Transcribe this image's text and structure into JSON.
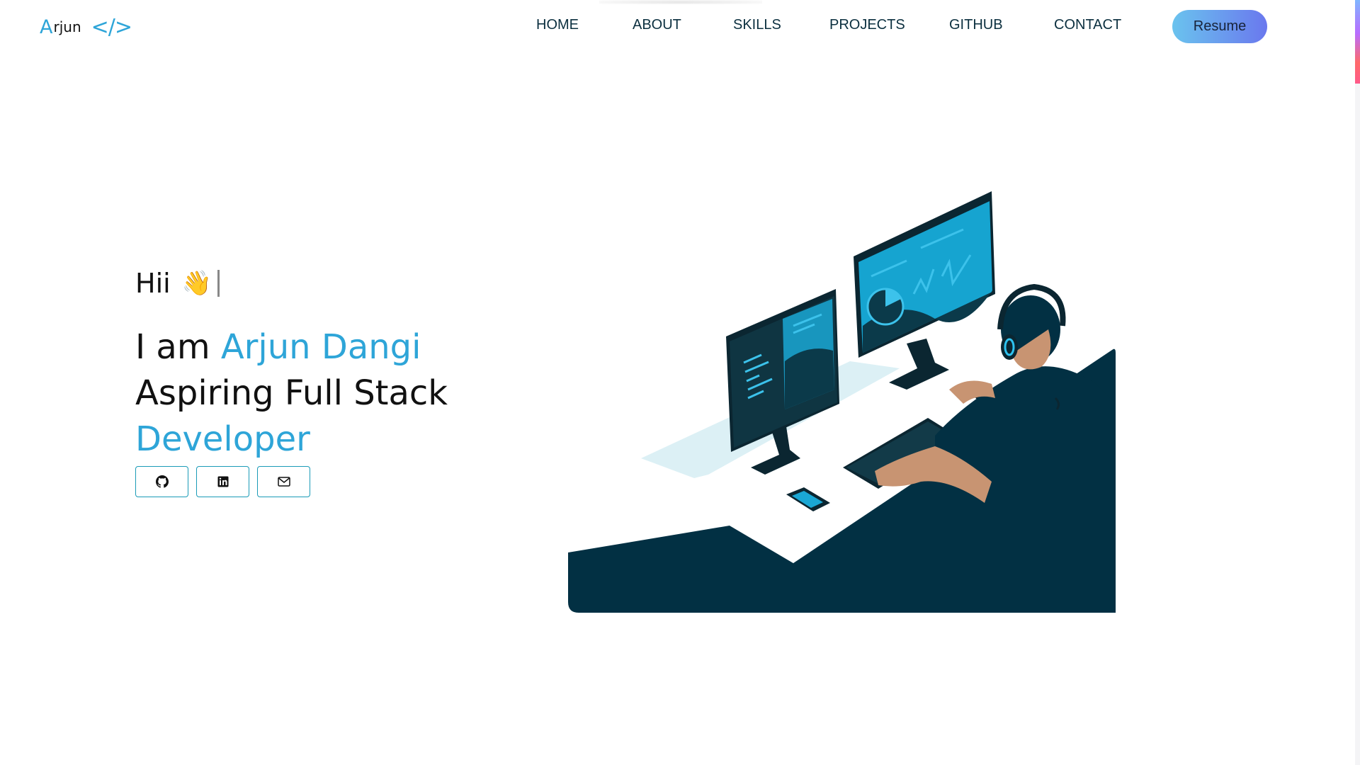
{
  "header": {
    "logo": {
      "first_letter": "A",
      "rest": "rjun",
      "code_symbol": "</>"
    },
    "nav": [
      "HOME",
      "ABOUT",
      "SKILLS",
      "PROJECTS",
      "GITHUB",
      "CONTACT"
    ],
    "resume_label": "Resume"
  },
  "hero": {
    "greeting": "Hii",
    "wave_emoji": "👋",
    "intro_prefix": "I am ",
    "name": "Arjun Dangi",
    "role_line": "Aspiring Full Stack",
    "role_highlight": "Developer"
  },
  "social": [
    {
      "icon": "github-icon"
    },
    {
      "icon": "linkedin-icon"
    },
    {
      "icon": "mail-icon"
    }
  ],
  "colors": {
    "accent": "#2ea5d8",
    "nav_text": "#0b2f3f",
    "illustration_dark": "#023043",
    "social_border": "#1a9bb7",
    "resume_gradient": [
      "#6ac3ee",
      "#6a78ee"
    ]
  }
}
